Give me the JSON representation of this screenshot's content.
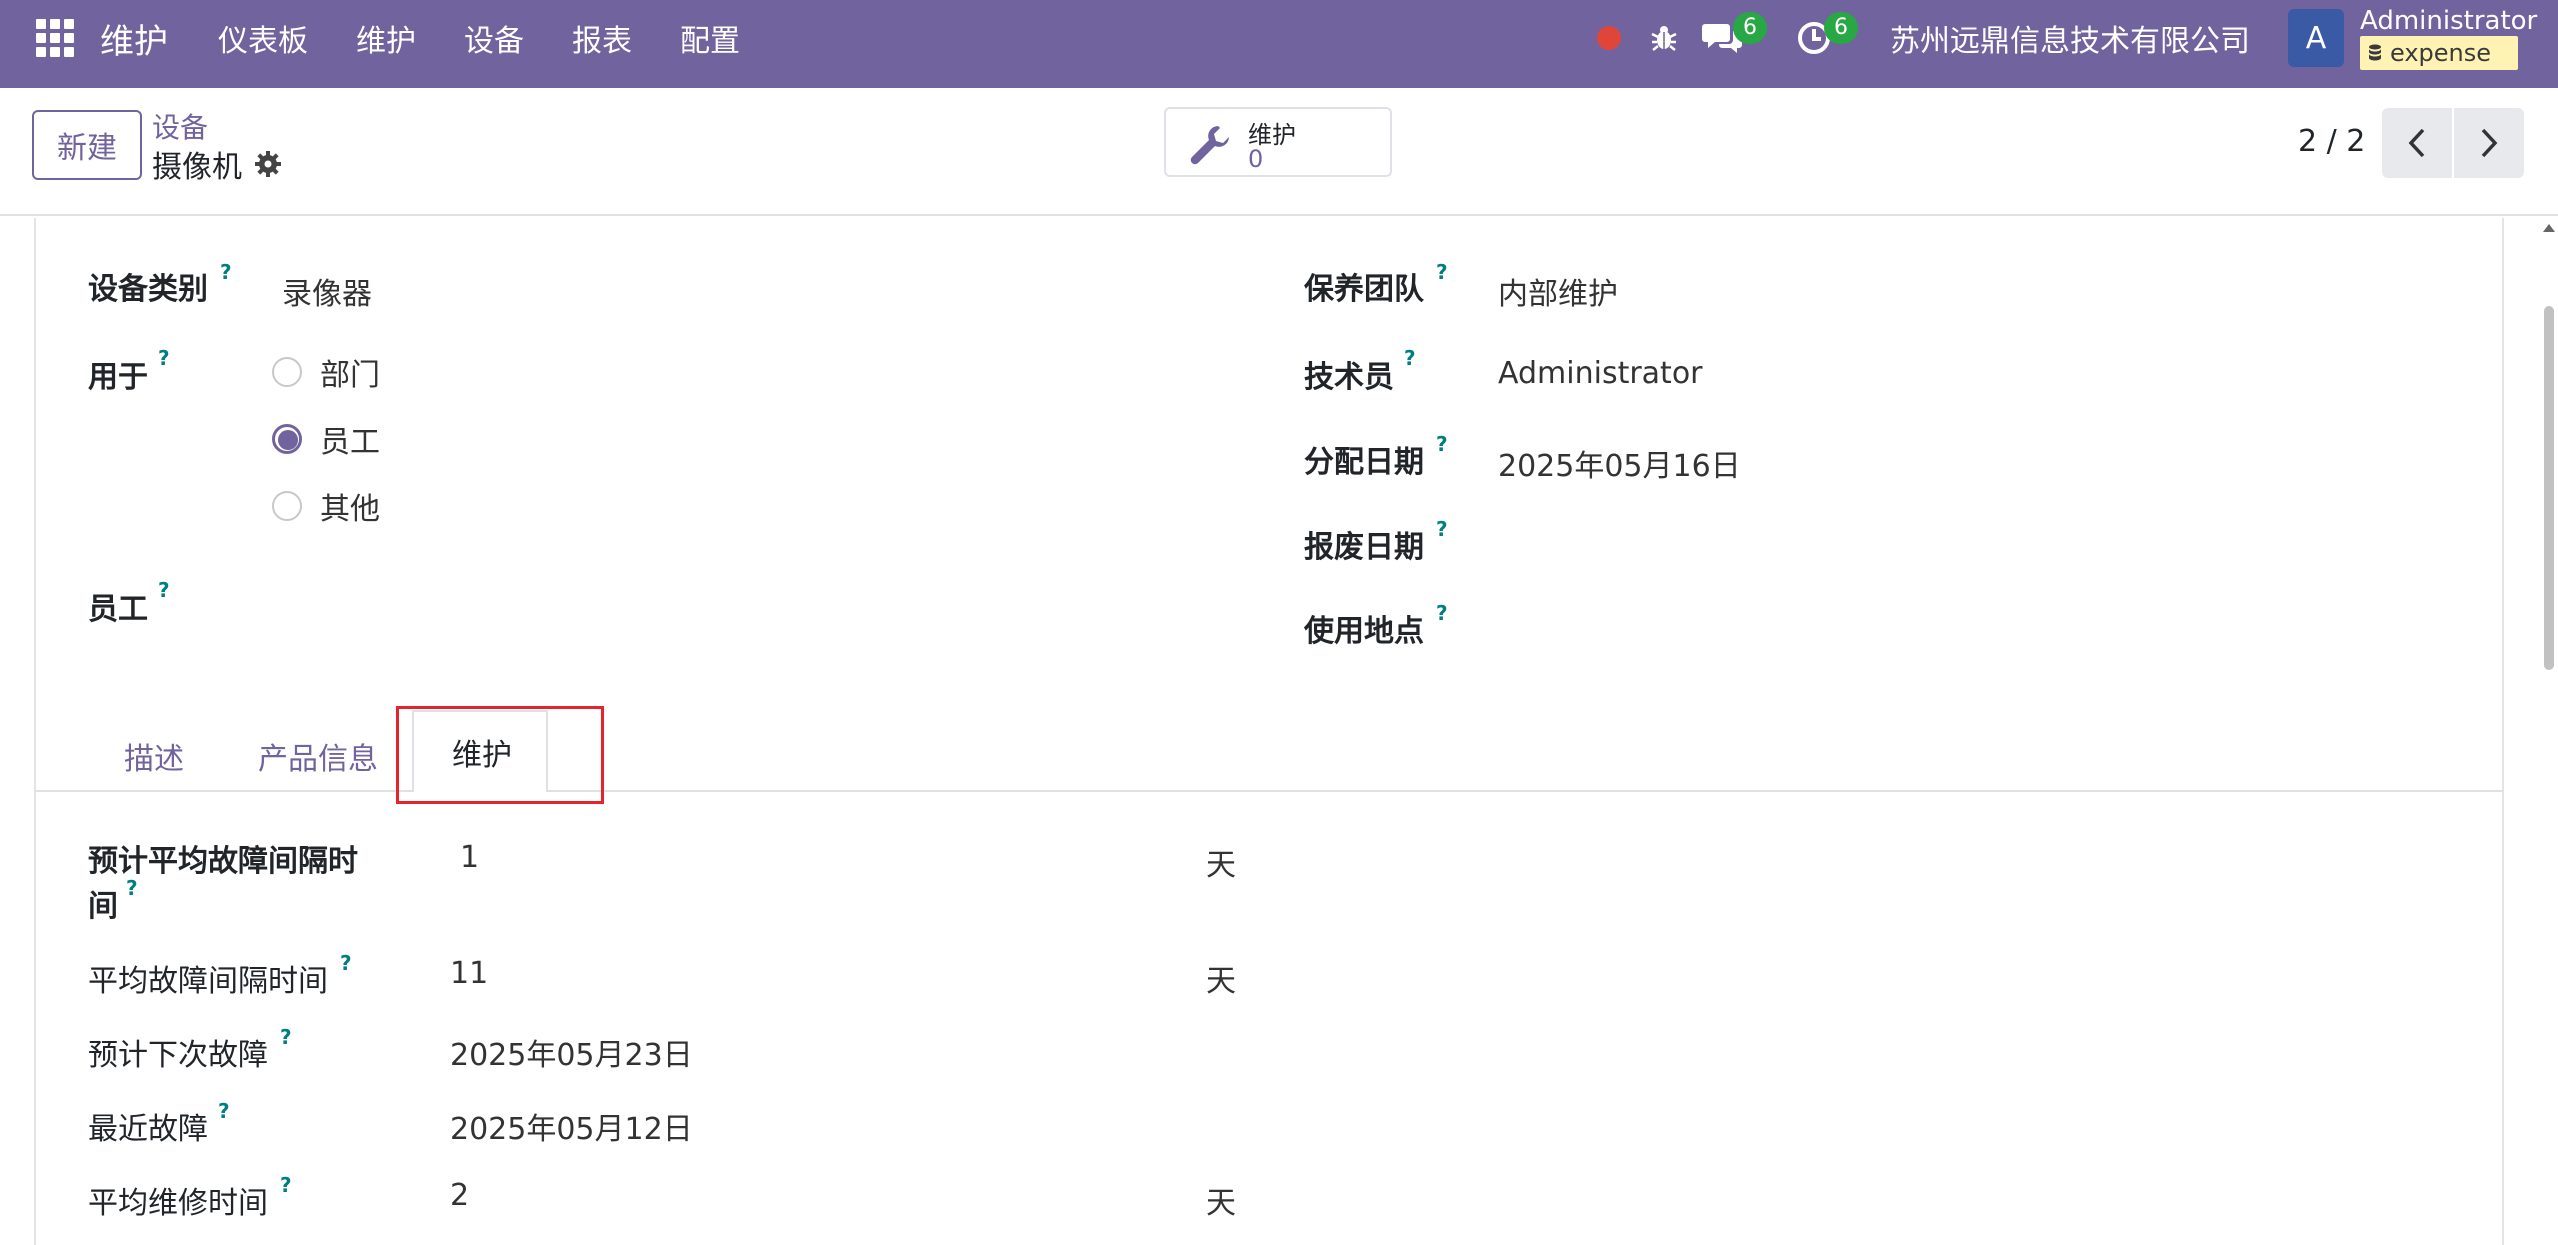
{
  "navbar": {
    "app_name": "维护",
    "menu": [
      "仪表板",
      "维护",
      "设备",
      "报表",
      "配置"
    ],
    "chat_count": "6",
    "activity_count": "6",
    "company": "苏州远鼎信息技术有限公司",
    "avatar_letter": "A",
    "user_name": "Administrator",
    "database": "expense"
  },
  "control_panel": {
    "new_button": "新建",
    "breadcrumb_parent": "设备",
    "breadcrumb_current": "摄像机",
    "smart_button_label": "维护",
    "smart_button_count": "0",
    "pager": "2 / 2"
  },
  "form": {
    "category_label": "设备类别",
    "category_value": "录像器",
    "used_for_label": "用于",
    "used_for_options": [
      {
        "label": "部门",
        "selected": false
      },
      {
        "label": "员工",
        "selected": true
      },
      {
        "label": "其他",
        "selected": false
      }
    ],
    "employee_label": "员工",
    "team_label": "保养团队",
    "team_value": "内部维护",
    "technician_label": "技术员",
    "technician_value": "Administrator",
    "assign_date_label": "分配日期",
    "assign_date_value": "2025年05月16日",
    "scrap_date_label": "报废日期",
    "location_label": "使用地点",
    "help_mark": "?"
  },
  "tabs": [
    "描述",
    "产品信息",
    "维护"
  ],
  "maintenance_tab": {
    "expected_mtbf_label_line1": "预计平均故障间隔时",
    "expected_mtbf_label_line2": "间",
    "expected_mtbf_value": "1",
    "mtbf_label": "平均故障间隔时间",
    "mtbf_value": "11",
    "next_failure_label": "预计下次故障",
    "next_failure_value": "2025年05月23日",
    "last_failure_label": "最近故障",
    "last_failure_value": "2025年05月12日",
    "mttr_label": "平均维修时间",
    "mttr_value": "2",
    "unit_days": "天"
  },
  "colors": {
    "brand": "#71639e",
    "badge": "#28a745",
    "highlight": "#e5242d",
    "help": "#017e84"
  }
}
